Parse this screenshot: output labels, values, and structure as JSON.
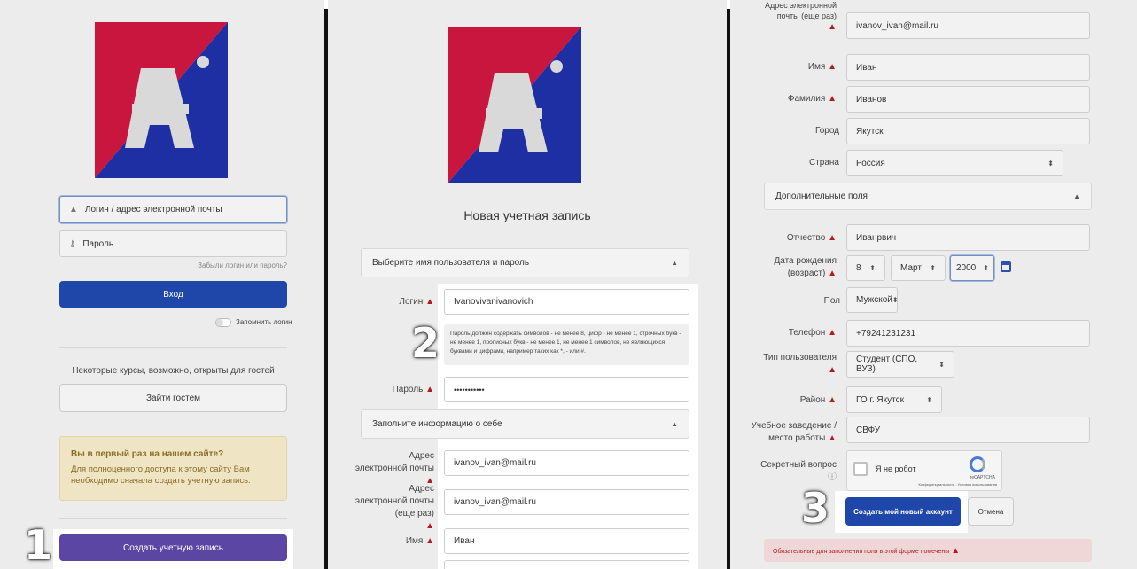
{
  "colors": {
    "accent_blue": "#1f46a9",
    "purple": "#5c46a3",
    "logo_red": "#c8163e",
    "logo_blue": "#1e2fa4"
  },
  "steps": {
    "step1": "1",
    "step2": "2",
    "step3": "3"
  },
  "login": {
    "login_placeholder": "Логин / адрес электронной почты",
    "password_placeholder": "Пароль",
    "forgot_link": "Забыли логин или пароль?",
    "login_button": "Вход",
    "remember_label": "Запомнить логин",
    "guest_text": "Некоторые курсы, возможно, открыты для гостей",
    "guest_button": "Зайти гостем",
    "notice_title": "Вы в первый раз на нашем сайте?",
    "notice_text": "Для полноценного доступа к этому сайту Вам необходимо сначала создать учетную запись.",
    "create_account_button": "Создать учетную запись"
  },
  "signup": {
    "title": "Новая учетная запись",
    "section1": "Выберите имя пользователя и пароль",
    "login_label": "Логин",
    "login_value": "Ivanovivanivanovich",
    "password_hint": "Пароль должен содержать символов - не менее 8, цифр - не менее 1, строчных букв - не менее 1, прописных букв - не менее 1, не менее 1 символов, не являющихся буквами и цифрами, например таких как *, - или #.",
    "password_label": "Пароль",
    "password_value": "•••••••••••",
    "section2": "Заполните информацию о себе",
    "email_label": "Адрес электронной почты",
    "email_value": "ivanov_ivan@mail.ru",
    "email2_label": "Адрес электронной почты (еще раз)",
    "email2_value": "ivanov_ivan@mail.ru",
    "name_label": "Имя",
    "name_value": "Иван"
  },
  "profile": {
    "email2_label": "Адрес электронной почты (еще раз)",
    "email2_value": "ivanov_ivan@mail.ru",
    "name_label": "Имя",
    "name_value": "Иван",
    "surname_label": "Фамилия",
    "surname_value": "Иванов",
    "city_label": "Город",
    "city_value": "Якутск",
    "country_label": "Страна",
    "country_value": "Россия",
    "extra_section": "Дополнительные поля",
    "patronymic_label": "Отчество",
    "patronymic_value": "Иванрвич",
    "birth_label": "Дата рождения (возраст)",
    "birth_day": "8",
    "birth_month": "Март",
    "birth_year": "2000",
    "gender_label": "Пол",
    "gender_value": "Мужской",
    "phone_label": "Телефон",
    "phone_value": "+79241231231",
    "usertype_label": "Тип пользователя",
    "usertype_value": "Студент (СПО, ВУЗ)",
    "district_label": "Район",
    "district_value": "ГО г. Якутск",
    "school_label": "Учебное заведение / место работы",
    "school_value": "СВФУ",
    "captcha_label": "Секретный вопрос",
    "captcha_text": "Я не робот",
    "captcha_brand": "reCAPTCHA",
    "captcha_terms": "Конфиденциальность - Условия использования",
    "create_button": "Создать мой новый аккаунт",
    "cancel_button": "Отмена",
    "required_note": "Обязательные для заполнения поля в этой форме помечены"
  }
}
